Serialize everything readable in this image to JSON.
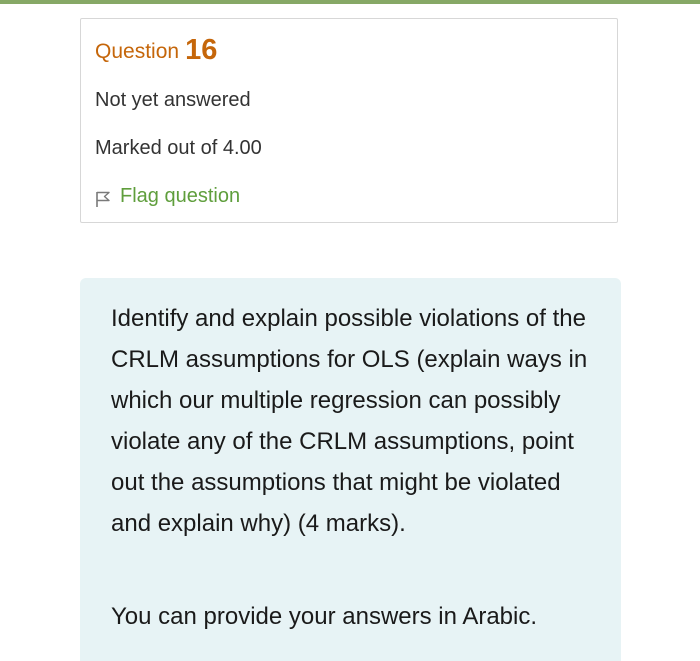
{
  "question": {
    "label": "Question",
    "number": "16",
    "state": "Not yet answered",
    "grade": "Marked out of 4.00",
    "flag_label": "Flag question",
    "flag_icon": "flag-outline-icon"
  },
  "question_text": {
    "body": "Identify and explain possible violations of the CRLM assumptions for OLS (explain ways in which our multiple regression can possibly violate any of the CRLM assumptions, point out the assumptions that might be violated and explain why) (4 marks).",
    "note": "You can provide your answers in Arabic."
  },
  "colors": {
    "accent_bar": "#86a866",
    "question_number": "#c5660a",
    "flag_link": "#5f9e3c",
    "question_text_bg": "#e7f3f5"
  }
}
